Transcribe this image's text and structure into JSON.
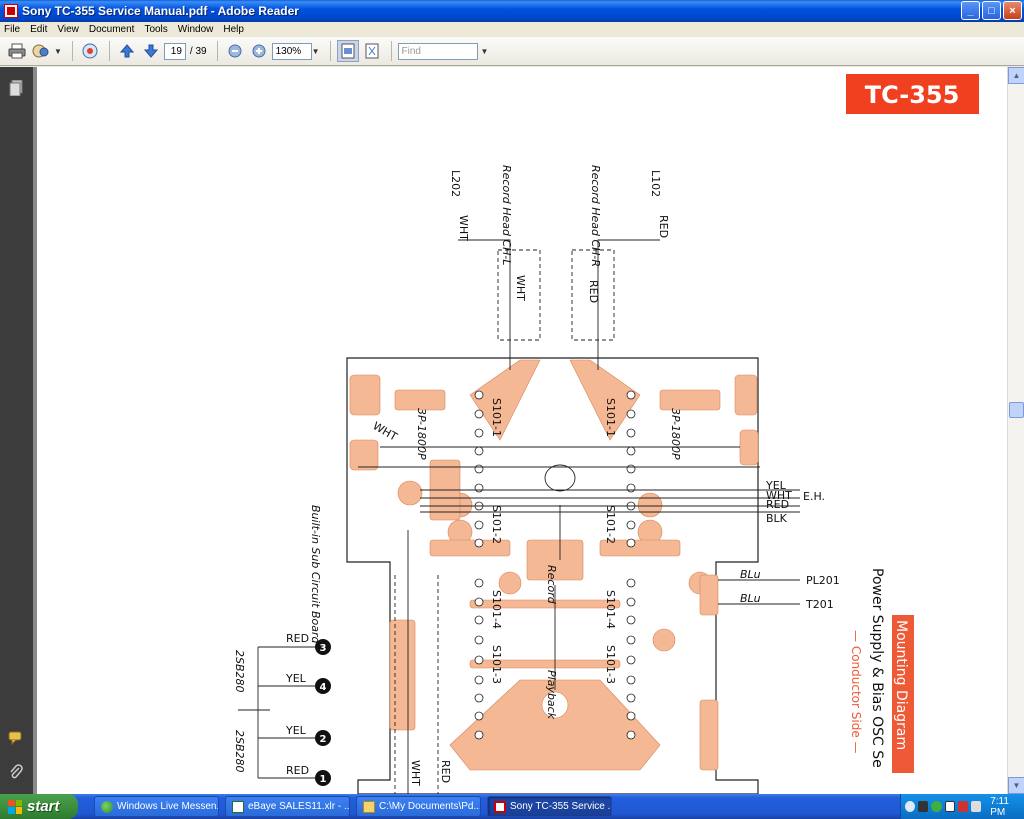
{
  "window": {
    "title": "Sony TC-355 Service Manual.pdf - Adobe Reader",
    "controls": [
      "_",
      "□",
      "×"
    ]
  },
  "menu": [
    "File",
    "Edit",
    "View",
    "Document",
    "Tools",
    "Window",
    "Help"
  ],
  "toolbar": {
    "page_current": "19",
    "page_total": "/ 39",
    "zoom": "130%",
    "find_placeholder": "Find"
  },
  "document": {
    "model_badge": "TC-355",
    "diagram_title": "Mounting Diagram",
    "diagram_subtitle": "Power Supply & Bias OSC Se",
    "diagram_side": "— Conductor Side —",
    "labels": {
      "l202": "L202",
      "l102": "L102",
      "rec_head_l": "Record Head CH-L",
      "rec_head_r": "Record Head CH-R",
      "wht": "WHT",
      "red": "RED",
      "yel": "YEL",
      "blk": "BLK",
      "blu": "BLu",
      "eh": "E.H.",
      "pl201": "PL201",
      "t201": "T201",
      "record": "Record",
      "playback": "Playback",
      "builtin": "Built-in Sub Circuit Board",
      "xsistor": "2SB280",
      "c_val": "3P-1800P",
      "sw1": "S101-1",
      "sw2": "S101-2",
      "sw3": "S101-3",
      "sw4": "S101-4",
      "n3": "3",
      "n4": "4",
      "n2": "2",
      "n1": "1"
    },
    "colors": {
      "badge": "#f0401f",
      "copper": "#f5b894",
      "title_box": "#ef5a36"
    }
  },
  "taskbar": {
    "start_label": "start",
    "tasks": [
      {
        "label": "Windows Live Messen...",
        "icon": "messenger-icon"
      },
      {
        "label": "eBaye SALES11.xlr - ...",
        "icon": "spreadsheet-icon"
      },
      {
        "label": "C:\\My Documents\\Pd...",
        "icon": "folder-icon"
      },
      {
        "label": "Sony TC-355 Service ...",
        "icon": "pdf-icon"
      }
    ],
    "clock": "7:11 PM"
  }
}
